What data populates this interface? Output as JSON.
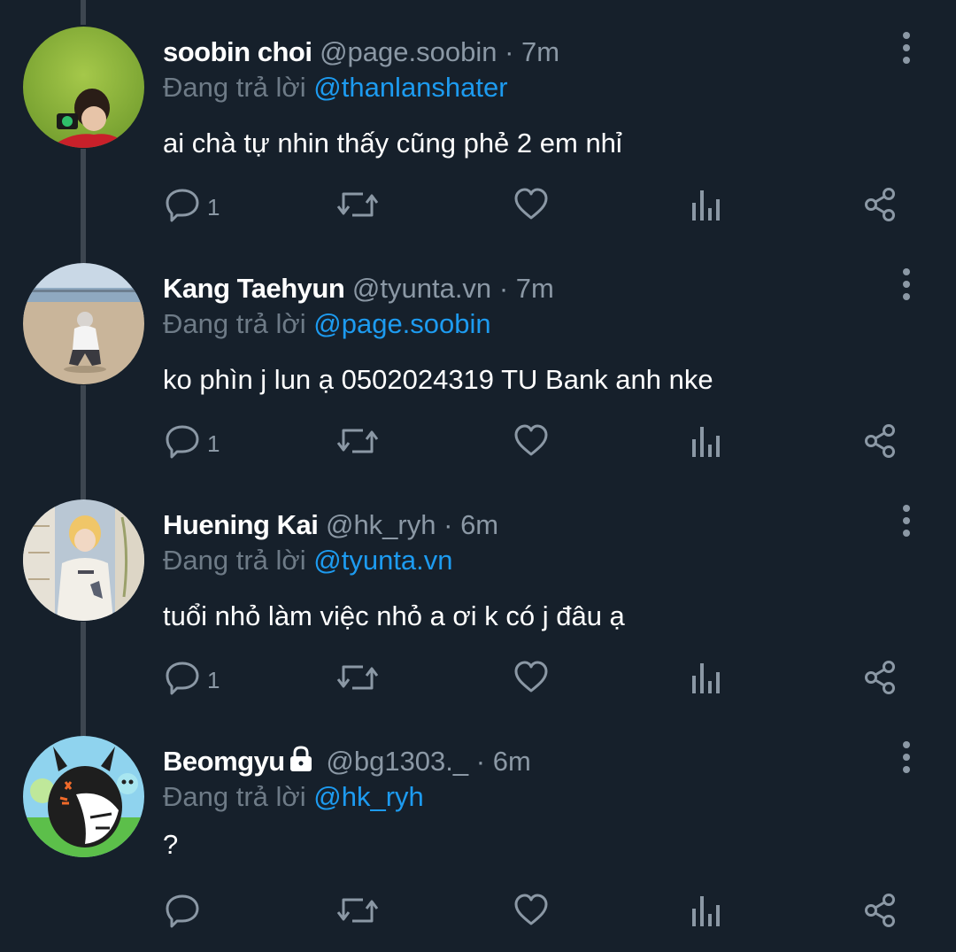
{
  "tweets": [
    {
      "name": "soobin choi",
      "handle": "@page.soobin",
      "dot": "·",
      "time": "7m",
      "reply_label": "Đang trả lời",
      "reply_to": "@thanlanshater",
      "text": "ai chà tự nhin thấy cũng phẻ 2 em nhỉ",
      "reply_count": "1",
      "locked": false
    },
    {
      "name": "Kang Taehyun",
      "handle": "@tyunta.vn",
      "dot": "·",
      "time": "7m",
      "reply_label": "Đang trả lời",
      "reply_to": "@page.soobin",
      "text": "ko phìn j lun ạ 0502024319 TU Bank anh nke",
      "reply_count": "1",
      "locked": false
    },
    {
      "name": "Huening Kai",
      "handle": "@hk_ryh",
      "dot": "·",
      "time": "6m",
      "reply_label": "Đang trả lời",
      "reply_to": "@tyunta.vn",
      "text": "tuổi nhỏ làm việc nhỏ a ơi k có j đâu ạ",
      "reply_count": "1",
      "locked": false
    },
    {
      "name": "Beomgyu",
      "handle": "@bg1303._",
      "dot": "·",
      "time": "6m",
      "reply_label": "Đang trả lời",
      "reply_to": "@hk_ryh",
      "text": "?",
      "reply_count": "",
      "locked": true
    }
  ],
  "icons": {
    "reply": "reply-icon",
    "retweet": "retweet-icon",
    "like": "heart-icon",
    "views": "analytics-icon",
    "share": "share-icon",
    "more": "more-vertical-icon",
    "lock": "lock-icon"
  },
  "colors": {
    "background": "#16202b",
    "text": "#ffffff",
    "muted": "#8b98a5",
    "mention": "#1d9bf0",
    "thread_line": "#3d4650"
  }
}
